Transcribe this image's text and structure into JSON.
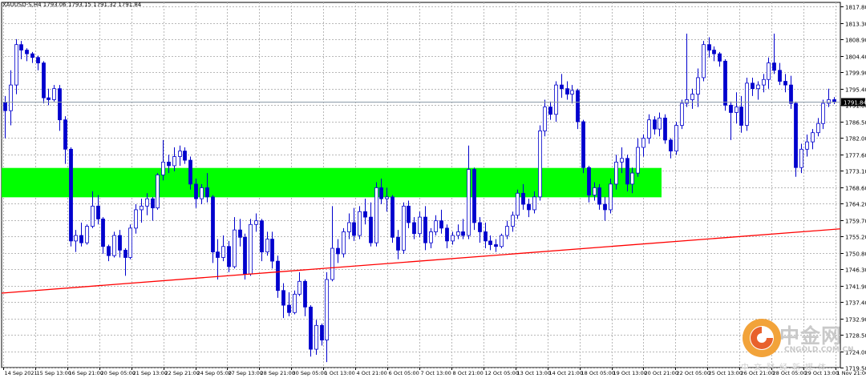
{
  "header": {
    "symbol_text": "XAUUSD-S,H4 1793.06 1793.15 1791.32 1791.84"
  },
  "watermark": {
    "brand": "中金网",
    "url": "CNGOLD.COM.CN",
    "slogan": "中文财经新媒体"
  },
  "chart_data": {
    "type": "candlestick",
    "symbol": "XAUUSD-S",
    "timeframe": "H4",
    "ohlc_header": {
      "open": 1793.06,
      "high": 1793.15,
      "low": 1791.32,
      "close": 1791.84
    },
    "current_price": 1791.84,
    "ylim": [
      1719.5,
      1819.0
    ],
    "y_ticks": [
      "1817.80",
      "1813.30",
      "1808.90",
      "1804.40",
      "1799.90",
      "1795.40",
      "1791.00",
      "1786.50",
      "1782.00",
      "1777.60",
      "1773.10",
      "1768.60",
      "1764.20",
      "1759.70",
      "1755.20",
      "1750.80",
      "1746.30",
      "1741.90",
      "1737.40",
      "1732.90",
      "1728.50",
      "1724.00",
      "1719.50"
    ],
    "x_ticks": [
      "14 Sep 2021",
      "15 Sep 13:00",
      "16 Sep 21:00",
      "20 Sep 05:00",
      "21 Sep 13:00",
      "22 Sep 21:00",
      "24 Sep 05:00",
      "27 Sep 13:00",
      "28 Sep 21:00",
      "30 Sep 05:00",
      "1 Oct 13:00",
      "4 Oct 21:00",
      "6 Oct 05:00",
      "7 Oct 13:00",
      "8 Oct 21:00",
      "12 Oct 05:00",
      "13 Oct 13:00",
      "14 Oct 21:00",
      "18 Oct 05:00",
      "19 Oct 13:00",
      "20 Oct 21:00",
      "22 Oct 05:00",
      "25 Oct 13:00",
      "26 Oct 21:00",
      "28 Oct 05:00",
      "29 Oct 13:00",
      "1 Nov 21:00"
    ],
    "grid": true,
    "bull_color": "#ffffff",
    "bear_color": "#0000cd",
    "wick_color": "#0000cd",
    "zone": {
      "from": 1765.9,
      "to": 1773.9,
      "color": "#00ff00"
    },
    "trendline": {
      "color": "#ff0000",
      "start": 1739.8,
      "end": 1757.3
    },
    "candles": [
      [
        1791.8,
        1793.5,
        1782.0,
        1789.5
      ],
      [
        1789.5,
        1800.5,
        1785.5,
        1796.5
      ],
      [
        1796.5,
        1809.0,
        1794.0,
        1807.5
      ],
      [
        1807.5,
        1808.5,
        1803.5,
        1806.0
      ],
      [
        1806.0,
        1806.5,
        1803.0,
        1805.0
      ],
      [
        1805.0,
        1805.5,
        1802.5,
        1804.0
      ],
      [
        1804.0,
        1804.5,
        1800.5,
        1802.5
      ],
      [
        1802.5,
        1803.0,
        1791.5,
        1793.0
      ],
      [
        1793.0,
        1795.5,
        1791.0,
        1792.5
      ],
      [
        1792.5,
        1796.5,
        1792.0,
        1795.5
      ],
      [
        1795.5,
        1796.5,
        1784.0,
        1787.0
      ],
      [
        1787.0,
        1788.0,
        1775.0,
        1779.0
      ],
      [
        1779.0,
        1779.5,
        1752.5,
        1754.0
      ],
      [
        1754.0,
        1757.0,
        1751.0,
        1755.5
      ],
      [
        1755.5,
        1759.0,
        1752.5,
        1753.5
      ],
      [
        1753.5,
        1758.5,
        1753.0,
        1758.0
      ],
      [
        1758.0,
        1767.5,
        1757.5,
        1763.5
      ],
      [
        1763.5,
        1766.5,
        1758.5,
        1760.0
      ],
      [
        1760.0,
        1760.5,
        1750.5,
        1752.5
      ],
      [
        1752.5,
        1753.0,
        1748.5,
        1750.0
      ],
      [
        1750.0,
        1756.5,
        1749.5,
        1755.5
      ],
      [
        1755.5,
        1757.0,
        1749.5,
        1751.5
      ],
      [
        1751.5,
        1752.0,
        1744.5,
        1749.5
      ],
      [
        1749.5,
        1758.5,
        1749.0,
        1757.5
      ],
      [
        1757.5,
        1764.0,
        1756.0,
        1762.5
      ],
      [
        1762.5,
        1765.5,
        1759.0,
        1763.5
      ],
      [
        1763.5,
        1767.0,
        1761.0,
        1765.5
      ],
      [
        1765.5,
        1766.0,
        1759.5,
        1763.0
      ],
      [
        1763.0,
        1772.5,
        1762.5,
        1772.0
      ],
      [
        1772.0,
        1781.5,
        1770.5,
        1775.5
      ],
      [
        1775.5,
        1777.5,
        1772.5,
        1774.5
      ],
      [
        1774.5,
        1779.5,
        1773.0,
        1777.0
      ],
      [
        1777.0,
        1780.0,
        1774.5,
        1778.5
      ],
      [
        1778.5,
        1779.5,
        1775.0,
        1776.0
      ],
      [
        1776.0,
        1777.0,
        1768.0,
        1769.5
      ],
      [
        1769.5,
        1771.0,
        1763.0,
        1765.5
      ],
      [
        1765.5,
        1769.5,
        1764.0,
        1768.5
      ],
      [
        1768.5,
        1772.5,
        1764.5,
        1766.0
      ],
      [
        1766.0,
        1766.5,
        1748.0,
        1751.0
      ],
      [
        1751.0,
        1754.5,
        1743.5,
        1749.5
      ],
      [
        1749.5,
        1755.5,
        1748.5,
        1752.5
      ],
      [
        1752.5,
        1754.0,
        1745.5,
        1747.0
      ],
      [
        1747.0,
        1760.5,
        1746.5,
        1757.0
      ],
      [
        1757.0,
        1760.0,
        1752.5,
        1755.0
      ],
      [
        1755.0,
        1756.0,
        1743.5,
        1745.0
      ],
      [
        1745.0,
        1760.0,
        1744.5,
        1758.5
      ],
      [
        1758.5,
        1761.5,
        1756.5,
        1759.5
      ],
      [
        1759.5,
        1760.0,
        1748.5,
        1751.0
      ],
      [
        1751.0,
        1756.5,
        1750.0,
        1754.5
      ],
      [
        1754.5,
        1756.5,
        1746.5,
        1748.5
      ],
      [
        1748.5,
        1750.0,
        1738.5,
        1740.5
      ],
      [
        1740.5,
        1742.5,
        1733.0,
        1736.5
      ],
      [
        1736.5,
        1740.0,
        1733.5,
        1734.5
      ],
      [
        1734.5,
        1740.5,
        1734.0,
        1739.5
      ],
      [
        1739.5,
        1745.5,
        1739.0,
        1743.0
      ],
      [
        1743.0,
        1743.5,
        1733.5,
        1736.0
      ],
      [
        1736.0,
        1736.5,
        1722.5,
        1724.5
      ],
      [
        1724.5,
        1732.5,
        1723.0,
        1731.0
      ],
      [
        1731.0,
        1731.5,
        1725.5,
        1727.0
      ],
      [
        1727.0,
        1745.5,
        1721.0,
        1743.5
      ],
      [
        1743.5,
        1763.5,
        1743.0,
        1752.0
      ],
      [
        1752.0,
        1754.5,
        1748.0,
        1750.5
      ],
      [
        1750.5,
        1757.5,
        1749.5,
        1756.5
      ],
      [
        1756.5,
        1761.5,
        1754.5,
        1759.0
      ],
      [
        1759.0,
        1763.0,
        1754.0,
        1755.5
      ],
      [
        1755.5,
        1763.5,
        1754.5,
        1762.0
      ],
      [
        1762.0,
        1765.5,
        1758.5,
        1760.5
      ],
      [
        1760.5,
        1764.5,
        1752.5,
        1753.5
      ],
      [
        1753.5,
        1770.0,
        1752.5,
        1768.5
      ],
      [
        1768.5,
        1771.0,
        1764.0,
        1765.5
      ],
      [
        1765.5,
        1768.5,
        1762.0,
        1766.0
      ],
      [
        1766.0,
        1766.5,
        1753.5,
        1755.0
      ],
      [
        1755.0,
        1757.0,
        1749.0,
        1751.5
      ],
      [
        1751.5,
        1764.5,
        1750.5,
        1763.5
      ],
      [
        1763.5,
        1765.0,
        1757.5,
        1759.0
      ],
      [
        1759.0,
        1760.5,
        1754.5,
        1756.0
      ],
      [
        1756.0,
        1762.0,
        1755.0,
        1760.5
      ],
      [
        1760.5,
        1763.5,
        1751.5,
        1753.5
      ],
      [
        1753.5,
        1757.5,
        1752.0,
        1756.5
      ],
      [
        1756.5,
        1761.0,
        1755.5,
        1759.5
      ],
      [
        1759.5,
        1762.5,
        1756.0,
        1757.5
      ],
      [
        1757.5,
        1758.5,
        1752.0,
        1754.0
      ],
      [
        1754.0,
        1756.5,
        1753.0,
        1755.5
      ],
      [
        1755.5,
        1758.5,
        1754.5,
        1756.5
      ],
      [
        1756.5,
        1760.0,
        1754.5,
        1755.5
      ],
      [
        1755.5,
        1780.0,
        1754.5,
        1773.5
      ],
      [
        1773.5,
        1774.0,
        1757.0,
        1759.0
      ],
      [
        1759.0,
        1760.5,
        1753.5,
        1756.5
      ],
      [
        1756.5,
        1759.0,
        1752.0,
        1754.0
      ],
      [
        1754.0,
        1755.5,
        1751.5,
        1753.0
      ],
      [
        1753.0,
        1754.5,
        1751.0,
        1752.5
      ],
      [
        1752.5,
        1756.0,
        1752.0,
        1755.5
      ],
      [
        1755.5,
        1759.5,
        1754.5,
        1758.0
      ],
      [
        1758.0,
        1762.0,
        1756.5,
        1761.0
      ],
      [
        1761.0,
        1768.0,
        1760.0,
        1767.0
      ],
      [
        1767.0,
        1769.5,
        1762.5,
        1764.0
      ],
      [
        1764.0,
        1765.5,
        1760.5,
        1762.5
      ],
      [
        1762.5,
        1767.5,
        1761.5,
        1766.0
      ],
      [
        1766.0,
        1785.5,
        1765.0,
        1784.0
      ],
      [
        1784.0,
        1792.5,
        1782.5,
        1790.5
      ],
      [
        1790.5,
        1792.0,
        1787.0,
        1788.5
      ],
      [
        1788.5,
        1797.5,
        1786.5,
        1796.5
      ],
      [
        1796.5,
        1799.5,
        1793.0,
        1795.5
      ],
      [
        1795.5,
        1797.5,
        1792.5,
        1794.0
      ],
      [
        1794.0,
        1796.5,
        1791.5,
        1795.0
      ],
      [
        1795.0,
        1795.5,
        1784.5,
        1786.5
      ],
      [
        1786.5,
        1787.0,
        1772.5,
        1774.0
      ],
      [
        1774.0,
        1774.5,
        1764.5,
        1766.5
      ],
      [
        1766.5,
        1770.0,
        1765.0,
        1768.5
      ],
      [
        1768.5,
        1769.5,
        1762.5,
        1764.0
      ],
      [
        1764.0,
        1766.0,
        1759.5,
        1762.5
      ],
      [
        1762.5,
        1771.0,
        1761.5,
        1769.5
      ],
      [
        1769.5,
        1777.5,
        1768.0,
        1775.5
      ],
      [
        1775.5,
        1779.5,
        1772.5,
        1776.5
      ],
      [
        1776.5,
        1777.5,
        1767.5,
        1769.5
      ],
      [
        1769.5,
        1774.0,
        1767.0,
        1772.5
      ],
      [
        1772.5,
        1782.0,
        1771.5,
        1779.5
      ],
      [
        1779.5,
        1783.0,
        1777.0,
        1782.0
      ],
      [
        1782.0,
        1788.5,
        1780.5,
        1787.0
      ],
      [
        1787.0,
        1788.0,
        1783.0,
        1784.5
      ],
      [
        1784.5,
        1789.0,
        1782.5,
        1787.5
      ],
      [
        1787.5,
        1788.5,
        1780.5,
        1781.5
      ],
      [
        1781.5,
        1782.0,
        1776.5,
        1778.5
      ],
      [
        1778.5,
        1786.5,
        1777.5,
        1785.5
      ],
      [
        1785.5,
        1792.5,
        1784.5,
        1791.5
      ],
      [
        1791.5,
        1810.5,
        1790.5,
        1792.5
      ],
      [
        1792.5,
        1795.5,
        1790.0,
        1794.0
      ],
      [
        1794.0,
        1801.0,
        1790.5,
        1798.5
      ],
      [
        1798.5,
        1808.5,
        1797.5,
        1807.5
      ],
      [
        1807.5,
        1809.5,
        1804.0,
        1806.0
      ],
      [
        1806.0,
        1807.0,
        1803.0,
        1805.0
      ],
      [
        1805.0,
        1805.5,
        1801.5,
        1803.0
      ],
      [
        1803.0,
        1803.5,
        1789.5,
        1791.0
      ],
      [
        1791.0,
        1792.0,
        1781.5,
        1789.0
      ],
      [
        1789.0,
        1794.5,
        1786.0,
        1790.5
      ],
      [
        1790.5,
        1793.5,
        1783.5,
        1785.5
      ],
      [
        1785.5,
        1798.5,
        1784.0,
        1797.0
      ],
      [
        1797.0,
        1798.5,
        1793.5,
        1795.5
      ],
      [
        1795.5,
        1797.5,
        1792.5,
        1796.5
      ],
      [
        1796.5,
        1799.5,
        1794.5,
        1798.0
      ],
      [
        1798.0,
        1804.0,
        1795.5,
        1802.5
      ],
      [
        1802.5,
        1810.5,
        1799.5,
        1800.5
      ],
      [
        1800.5,
        1802.5,
        1796.5,
        1797.5
      ],
      [
        1797.5,
        1799.5,
        1794.5,
        1796.5
      ],
      [
        1796.5,
        1799.0,
        1790.0,
        1791.5
      ],
      [
        1791.5,
        1792.0,
        1771.5,
        1774.0
      ],
      [
        1774.0,
        1780.5,
        1772.5,
        1779.0
      ],
      [
        1779.0,
        1783.0,
        1777.0,
        1781.0
      ],
      [
        1781.0,
        1784.5,
        1779.0,
        1783.5
      ],
      [
        1783.5,
        1787.5,
        1782.5,
        1786.0
      ],
      [
        1786.0,
        1792.5,
        1784.5,
        1791.5
      ],
      [
        1791.5,
        1795.5,
        1790.5,
        1792.5
      ],
      [
        1792.5,
        1793.2,
        1791.3,
        1791.8
      ]
    ]
  }
}
